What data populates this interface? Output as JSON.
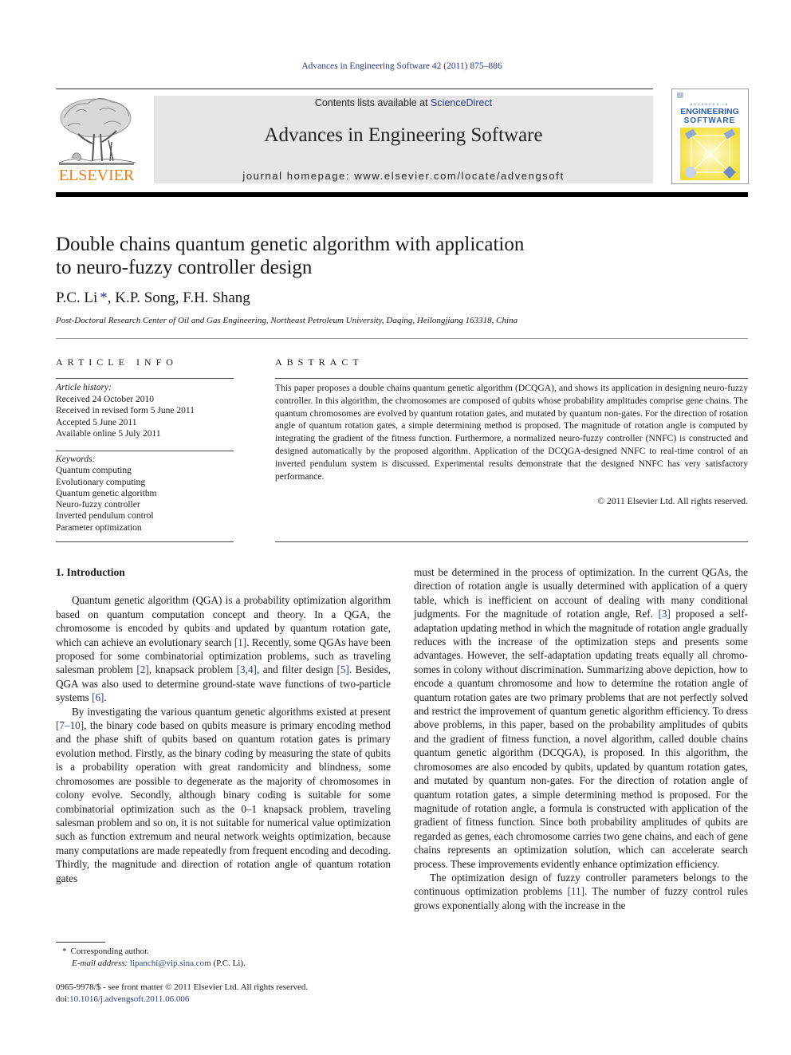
{
  "header": {
    "journal_ref": "Advances in Engineering Software 42 (2011) 875–886",
    "contents_prefix": "Contents lists available at ",
    "contents_link": "ScienceDirect",
    "journal_title": "Advances in Engineering Software",
    "homepage": "journal homepage: www.elsevier.com/locate/advengsoft",
    "publisher_wordmark": "ELSEVIER",
    "cover": {
      "small_line": "ADVANCES IN",
      "line1": "ENGINEERING",
      "line2": "SOFTWARE"
    },
    "colors": {
      "elsevier_orange": "#f07c1a",
      "link_blue": "#2a3a8c",
      "masthead_gray": "#e6e6e6",
      "cover_blue": "#2c5fb0",
      "cover_yellow": "#f7e64a"
    }
  },
  "article": {
    "title_line1": "Double chains quantum genetic algorithm with application",
    "title_line2": "to neuro-fuzzy controller design",
    "author1": "P.C. Li",
    "author1_mark": "*",
    "other_authors": ", K.P. Song, F.H. Shang",
    "affiliation": "Post-Doctoral Research Center of Oil and Gas Engineering, Northeast Petroleum University, Daqing, Heilongjiang 163318, China"
  },
  "article_info": {
    "heading": "ARTICLE INFO",
    "history_label": "Article history:",
    "history": [
      "Received 24 October 2010",
      "Received in revised form 5 June 2011",
      "Accepted 5 June 2011",
      "Available online 5 July 2011"
    ],
    "keywords_label": "Keywords:",
    "keywords": [
      "Quantum computing",
      "Evolutionary computing",
      "Quantum genetic algorithm",
      "Neuro-fuzzy controller",
      "Inverted pendulum control",
      "Parameter optimization"
    ]
  },
  "abstract": {
    "heading": "ABSTRACT",
    "text": "This paper proposes a double chains quantum genetic algorithm (DCQGA), and shows its application in designing neuro-fuzzy controller. In this algorithm, the chromosomes are composed of qubits whose probability amplitudes comprise gene chains. The quantum chromosomes are evolved by quantum rota­tion gates, and mutated by quantum non-gates. For the direction of rotation angle of quantum rotation gates, a simple determining method is proposed. The magnitude of rotation angle is computed by integrating the gradient of the fitness function. Furthermore, a normalized neuro-fuzzy controller (NNFC) is constructed and designed automatically by the proposed algorithm. Application of the DCQGA-designed NNFC to real-time control of an inverted pendulum system is discussed. Experimental results demonstrate that the designed NNFC has very satisfactory performance.",
    "copyright": "© 2011 Elsevier Ltd. All rights reserved."
  },
  "body": {
    "section_heading": "1. Introduction",
    "p1": [
      {
        "t": "Quantum genetic algorithm (QGA) is a probability optimization algorithm based on quantum computation concept and theory. In a QGA, the chromosome is encoded by qubits and updated by quan­tum rotation gate, which can achieve an evolutionary search "
      },
      {
        "ref": "[1]"
      },
      {
        "t": ". Recently, some QGAs have been proposed for some combinatorial optimization problems, such as traveling salesman problem "
      },
      {
        "ref": "[2]"
      },
      {
        "t": ", knapsack problem "
      },
      {
        "ref": "[3,4]"
      },
      {
        "t": ", and filter design "
      },
      {
        "ref": "[5]"
      },
      {
        "t": ". Besides, QGA was also used to determine ground-state wave functions of two-particle systems "
      },
      {
        "ref": "[6]"
      },
      {
        "t": "."
      }
    ],
    "p2": [
      {
        "t": "By investigating the various quantum genetic algorithms existed at present "
      },
      {
        "ref": "[7–10]"
      },
      {
        "t": ", the binary code based on qubits measure is pri­mary encoding method and the phase shift of qubits based on quan­tum rotation gates is primary evolution method. Firstly, as the binary coding by measuring the state of qubits is a probability oper­ation with great randomicity and blindness, some chromosomes are possible to degenerate as the majority of chromosomes in col­ony evolve. Secondly, although binary coding is suitable for some combinatorial optimization such as the 0–1 knapsack problem, traveling salesman problem and so on, it is not suitable for numer­ical value optimization such as function extremum and neural net­work weights optimization, because many computations are made repeatedly from frequent encoding and decoding. Thirdly, the mag­nitude and direction of rotation angle of quantum rotation gates"
      }
    ],
    "p3": [
      {
        "t": "must be determined in the process of optimization. In the current QGAs, the direction of rotation angle is usually determined with application of a query table, which is inefficient on account of deal­ing with many conditional judgments. For the magnitude of rota­tion angle, Ref. "
      },
      {
        "ref": "[3]"
      },
      {
        "t": " proposed a self-adaptation updating method in which the magnitude of rotation angle gradually reduces with the increase of the optimization steps and presents some advantages. However, the self-adaptation updating treats equally all chromo­somes in colony without discrimination. Summarizing above depic­tion, how to encode a quantum chromosome and how to determine the rotation angle of quantum rotation gates are two primary prob­lems that are not perfectly solved and restrict the improvement of quantum genetic algorithm efficiency. To dress above problems, in this paper, based on the probability amplitudes of qubits and the gradient of fitness function, a novel algorithm, called double chains quantum genetic algorithm (DCQGA), is proposed. In this algorithm, the chromosomes are also encoded by qubits, updated by quantum rotation gates, and mutated by quantum non-gates. For the direc­tion of rotation angle of quantum rotation gates, a simple determin­ing method is proposed. For the magnitude of rotation angle, a formula is constructed with application of the gradient of fitness function. Since both probability amplitudes of qubits are regarded as genes, each chromosome carries two gene chains, and each of gene chains represents an optimization solution, which can acceler­ate search process. These improvements evidently enhance optimi­zation efficiency."
      }
    ],
    "p4": [
      {
        "t": "The optimization design of fuzzy controller parameters belongs to the continuous optimization problems "
      },
      {
        "ref": "[11]"
      },
      {
        "t": ". The number of fuz­zy control rules grows exponentially along with the increase in the"
      }
    ]
  },
  "footnote": {
    "mark": "*",
    "corresponding": "Corresponding author.",
    "email_label": "E-mail address: ",
    "email": "lipanchi@vip.sina.com",
    "email_suffix": " (P.C. Li).",
    "issn_line": "0965-9978/$ - see front matter © 2011 Elsevier Ltd. All rights reserved.",
    "doi_prefix": "doi:",
    "doi": "10.1016/j.advengsoft.2011.06.006"
  }
}
